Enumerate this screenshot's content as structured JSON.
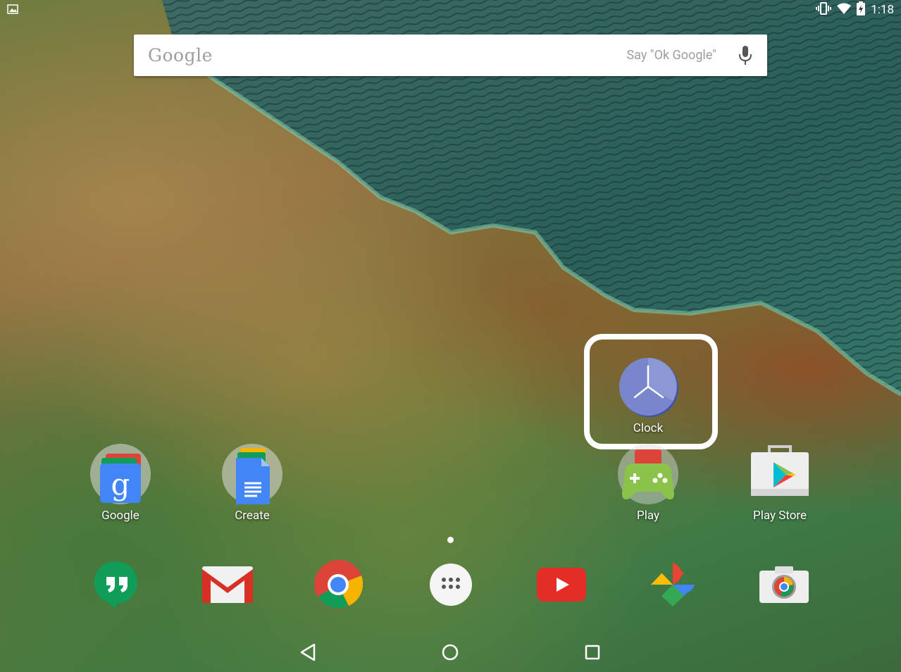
{
  "status_bar": {
    "time": "1:18",
    "icons": [
      "image-notification-icon",
      "vibrate-icon",
      "wifi-icon",
      "battery-charging-icon"
    ]
  },
  "search": {
    "logo": "Google",
    "hint": "Say \"Ok Google\"",
    "icon": "mic-icon"
  },
  "home_apps": [
    {
      "label": "Google",
      "icon": "google-folder-icon"
    },
    {
      "label": "Create",
      "icon": "create-folder-icon"
    },
    {
      "label": "Clock",
      "icon": "clock-icon"
    },
    {
      "label": "Play",
      "icon": "play-folder-icon"
    },
    {
      "label": "Play Store",
      "icon": "play-store-icon"
    }
  ],
  "dock_apps": [
    {
      "icon": "hangouts-icon"
    },
    {
      "icon": "gmail-icon"
    },
    {
      "icon": "chrome-icon"
    },
    {
      "icon": "app-drawer-icon"
    },
    {
      "icon": "youtube-icon"
    },
    {
      "icon": "photos-icon"
    },
    {
      "icon": "camera-icon"
    }
  ],
  "nav_bar": [
    "back-icon",
    "home-icon",
    "recents-icon"
  ],
  "colors": {
    "clock_face": "#7986cb",
    "highlight": "#ffffff",
    "youtube": "#e52d27",
    "hangouts": "#0f9d58"
  }
}
